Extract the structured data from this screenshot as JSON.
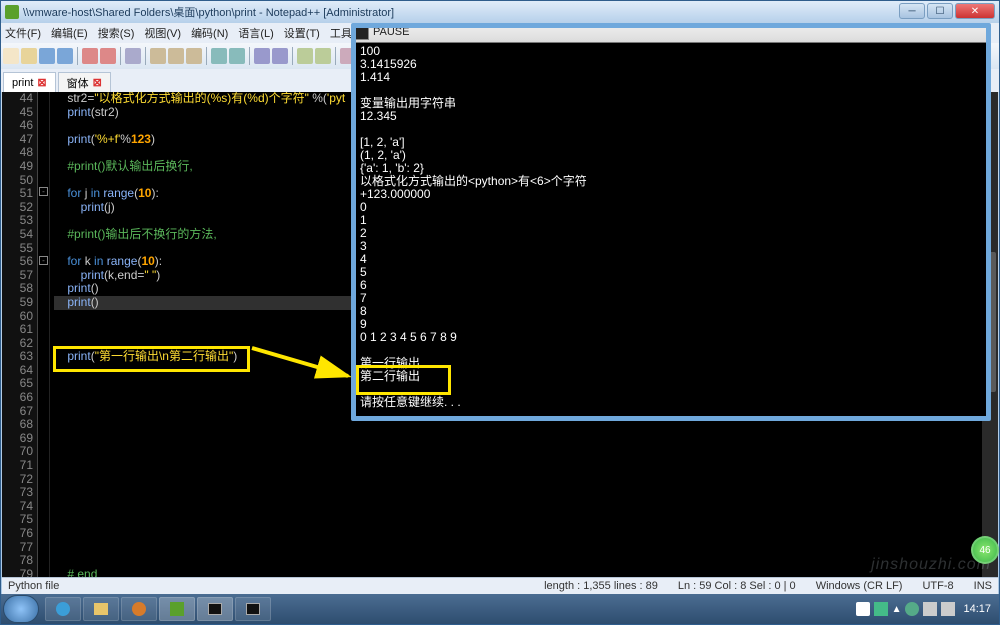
{
  "window": {
    "title": "\\\\vmware-host\\Shared Folders\\桌面\\python\\print - Notepad++ [Administrator]"
  },
  "menu": [
    "文件(F)",
    "编辑(E)",
    "搜索(S)",
    "视图(V)",
    "编码(N)",
    "语言(L)",
    "设置(T)",
    "工具(O)"
  ],
  "tabs": {
    "active": "print",
    "secondary": "窗体"
  },
  "gutter_start": 44,
  "gutter_end": 79,
  "code": [
    {
      "indent": "    ",
      "parts": [
        {
          "c": "id",
          "t": "str2"
        },
        {
          "c": "op",
          "t": "="
        },
        {
          "c": "str",
          "t": "\"以格式化方式输出的(%s)有(%d)个字符\""
        },
        {
          "c": "op",
          "t": " %"
        },
        {
          "c": "op",
          "t": "("
        },
        {
          "c": "str",
          "t": "'pyt"
        }
      ]
    },
    {
      "indent": "    ",
      "parts": [
        {
          "c": "fn",
          "t": "print"
        },
        {
          "c": "op",
          "t": "("
        },
        {
          "c": "id",
          "t": "str2"
        },
        {
          "c": "op",
          "t": ")"
        }
      ]
    },
    {
      "indent": "",
      "parts": []
    },
    {
      "indent": "    ",
      "parts": [
        {
          "c": "fn",
          "t": "print"
        },
        {
          "c": "op",
          "t": "("
        },
        {
          "c": "str",
          "t": "'%+f'"
        },
        {
          "c": "op",
          "t": "%"
        },
        {
          "c": "num1",
          "t": "123"
        },
        {
          "c": "op",
          "t": ")"
        }
      ]
    },
    {
      "indent": "",
      "parts": []
    },
    {
      "indent": "    ",
      "parts": [
        {
          "c": "cmt",
          "t": "#print()默认输出后换行,"
        }
      ]
    },
    {
      "indent": "",
      "parts": []
    },
    {
      "indent": "    ",
      "parts": [
        {
          "c": "kw",
          "t": "for"
        },
        {
          "c": "op",
          "t": " "
        },
        {
          "c": "id",
          "t": "j"
        },
        {
          "c": "op",
          "t": " "
        },
        {
          "c": "kw",
          "t": "in"
        },
        {
          "c": "op",
          "t": " "
        },
        {
          "c": "fn",
          "t": "range"
        },
        {
          "c": "op",
          "t": "("
        },
        {
          "c": "num1",
          "t": "10"
        },
        {
          "c": "op",
          "t": "):"
        }
      ]
    },
    {
      "indent": "        ",
      "parts": [
        {
          "c": "fn",
          "t": "print"
        },
        {
          "c": "op",
          "t": "("
        },
        {
          "c": "id",
          "t": "j"
        },
        {
          "c": "op",
          "t": ")"
        }
      ]
    },
    {
      "indent": "",
      "parts": []
    },
    {
      "indent": "    ",
      "parts": [
        {
          "c": "cmt",
          "t": "#print()输出后不换行的方法,"
        }
      ]
    },
    {
      "indent": "",
      "parts": []
    },
    {
      "indent": "    ",
      "parts": [
        {
          "c": "kw",
          "t": "for"
        },
        {
          "c": "op",
          "t": " "
        },
        {
          "c": "id",
          "t": "k"
        },
        {
          "c": "op",
          "t": " "
        },
        {
          "c": "kw",
          "t": "in"
        },
        {
          "c": "op",
          "t": " "
        },
        {
          "c": "fn",
          "t": "range"
        },
        {
          "c": "op",
          "t": "("
        },
        {
          "c": "num1",
          "t": "10"
        },
        {
          "c": "op",
          "t": "):"
        }
      ]
    },
    {
      "indent": "        ",
      "parts": [
        {
          "c": "fn",
          "t": "print"
        },
        {
          "c": "op",
          "t": "("
        },
        {
          "c": "id",
          "t": "k"
        },
        {
          "c": "op",
          "t": ","
        },
        {
          "c": "id",
          "t": "end"
        },
        {
          "c": "op",
          "t": "="
        },
        {
          "c": "str",
          "t": "\" \""
        },
        {
          "c": "op",
          "t": ")"
        }
      ]
    },
    {
      "indent": "    ",
      "parts": [
        {
          "c": "fn",
          "t": "print"
        },
        {
          "c": "op",
          "t": "()"
        }
      ]
    },
    {
      "indent": "    ",
      "hl": true,
      "parts": [
        {
          "c": "fn",
          "t": "print"
        },
        {
          "c": "op",
          "t": "()"
        }
      ]
    },
    {
      "indent": "",
      "parts": []
    },
    {
      "indent": "",
      "parts": []
    },
    {
      "indent": "",
      "parts": []
    },
    {
      "indent": "    ",
      "parts": [
        {
          "c": "fn",
          "t": "print"
        },
        {
          "c": "op",
          "t": "("
        },
        {
          "c": "str",
          "t": "\"第一行输出\\n第二行输出\""
        },
        {
          "c": "op",
          "t": ")"
        }
      ]
    },
    {
      "indent": "",
      "parts": []
    },
    {
      "indent": "",
      "parts": []
    },
    {
      "indent": "",
      "parts": []
    },
    {
      "indent": "",
      "parts": []
    },
    {
      "indent": "",
      "parts": []
    },
    {
      "indent": "",
      "parts": []
    },
    {
      "indent": "",
      "parts": []
    },
    {
      "indent": "",
      "parts": []
    },
    {
      "indent": "",
      "parts": []
    },
    {
      "indent": "",
      "parts": []
    },
    {
      "indent": "",
      "parts": []
    },
    {
      "indent": "",
      "parts": []
    },
    {
      "indent": "",
      "parts": []
    },
    {
      "indent": "",
      "parts": []
    },
    {
      "indent": "",
      "parts": []
    },
    {
      "indent": "    ",
      "parts": [
        {
          "c": "cmt",
          "t": "# end"
        }
      ]
    }
  ],
  "console": {
    "title": "PAUSE",
    "lines": [
      "100",
      "3.1415926",
      "1.414",
      "",
      "变量输出用字符串",
      "12.345",
      "",
      "[1, 2, 'a']",
      "(1, 2, 'a')",
      "{'a': 1, 'b': 2}",
      "以格式化方式输出的<python>有<6>个字符",
      "+123.000000",
      "0",
      "1",
      "2",
      "3",
      "4",
      "5",
      "6",
      "7",
      "8",
      "9",
      "0 1 2 3 4 5 6 7 8 9 ",
      "",
      "第一行输出",
      "第二行输出",
      "",
      "请按任意键继续. . ."
    ]
  },
  "status": {
    "lang": "Python file",
    "length": "length : 1,355    lines : 89",
    "pos": "Ln : 59    Col : 8    Sel : 0 | 0",
    "eol": "Windows (CR LF)",
    "enc": "UTF-8",
    "ins": "INS"
  },
  "clock": "14:17",
  "watermark": "jinshouzhi.com",
  "badge": "46"
}
